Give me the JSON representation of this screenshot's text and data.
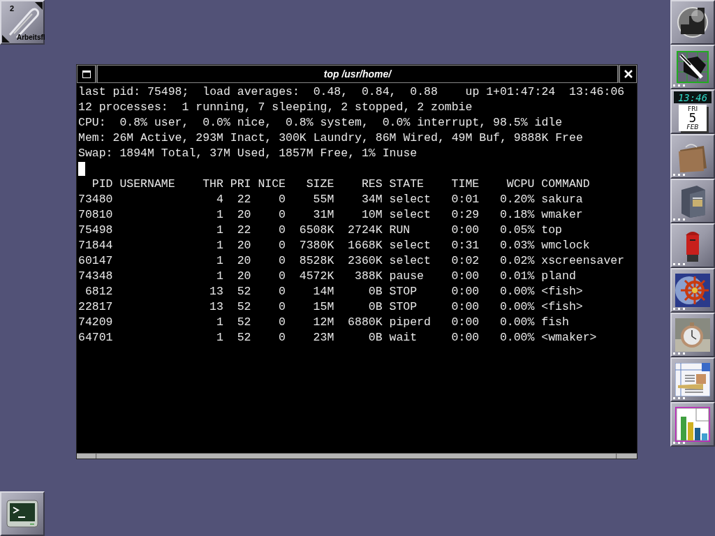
{
  "workspace": {
    "number": "2",
    "name": "Arbeitsfl"
  },
  "window": {
    "title": "top /usr/home/"
  },
  "terminal": {
    "summary": [
      "last pid: 75498;  load averages:  0.48,  0.84,  0.88    up 1+01:47:24  13:46:06",
      "12 processes:  1 running, 7 sleeping, 2 stopped, 2 zombie",
      "CPU:  0.8% user,  0.0% nice,  0.8% system,  0.0% interrupt, 98.5% idle",
      "Mem: 26M Active, 293M Inact, 300K Laundry, 86M Wired, 49M Buf, 9888K Free",
      "Swap: 1894M Total, 37M Used, 1857M Free, 1% Inuse"
    ]
  },
  "table": {
    "columns": [
      "PID",
      "USERNAME",
      "THR",
      "PRI",
      "NICE",
      "SIZE",
      "RES",
      "STATE",
      "TIME",
      "WCPU",
      "COMMAND"
    ],
    "rows": [
      {
        "pid": "73480",
        "thr": "4",
        "pri": "22",
        "nice": "0",
        "size": "55M",
        "res": "34M",
        "state": "select",
        "time": "0:01",
        "wcpu": "0.20%",
        "command": "sakura"
      },
      {
        "pid": "70810",
        "thr": "1",
        "pri": "20",
        "nice": "0",
        "size": "31M",
        "res": "10M",
        "state": "select",
        "time": "0:29",
        "wcpu": "0.18%",
        "command": "wmaker"
      },
      {
        "pid": "75498",
        "thr": "1",
        "pri": "22",
        "nice": "0",
        "size": "6508K",
        "res": "2724K",
        "state": "RUN",
        "time": "0:00",
        "wcpu": "0.05%",
        "command": "top"
      },
      {
        "pid": "71844",
        "thr": "1",
        "pri": "20",
        "nice": "0",
        "size": "7380K",
        "res": "1668K",
        "state": "select",
        "time": "0:31",
        "wcpu": "0.03%",
        "command": "wmclock"
      },
      {
        "pid": "60147",
        "thr": "1",
        "pri": "20",
        "nice": "0",
        "size": "8528K",
        "res": "2360K",
        "state": "select",
        "time": "0:02",
        "wcpu": "0.02%",
        "command": "xscreensaver"
      },
      {
        "pid": "74348",
        "thr": "1",
        "pri": "20",
        "nice": "0",
        "size": "4572K",
        "res": "388K",
        "state": "pause",
        "time": "0:00",
        "wcpu": "0.01%",
        "command": "pland"
      },
      {
        "pid": "6812",
        "thr": "13",
        "pri": "52",
        "nice": "0",
        "size": "14M",
        "res": "0B",
        "state": "STOP",
        "time": "0:00",
        "wcpu": "0.00%",
        "command": "<fish>"
      },
      {
        "pid": "22817",
        "thr": "13",
        "pri": "52",
        "nice": "0",
        "size": "15M",
        "res": "0B",
        "state": "STOP",
        "time": "0:00",
        "wcpu": "0.00%",
        "command": "<fish>"
      },
      {
        "pid": "74209",
        "thr": "1",
        "pri": "52",
        "nice": "0",
        "size": "12M",
        "res": "6880K",
        "state": "piperd",
        "time": "0:00",
        "wcpu": "0.00%",
        "command": "fish"
      },
      {
        "pid": "64701",
        "thr": "1",
        "pri": "52",
        "nice": "0",
        "size": "23M",
        "res": "0B",
        "state": "wait",
        "time": "0:00",
        "wcpu": "0.00%",
        "command": "<wmaker>"
      }
    ]
  },
  "dock": [
    {
      "kind": "sphere",
      "dots": false
    },
    {
      "kind": "tools",
      "dots": true
    },
    {
      "kind": "clock",
      "dots": false,
      "time": "13:46",
      "weekday": "FRI",
      "day": "5",
      "month": "FEB"
    },
    {
      "kind": "folder",
      "dots": true
    },
    {
      "kind": "cabinet",
      "dots": true
    },
    {
      "kind": "mailbox",
      "dots": true
    },
    {
      "kind": "helm",
      "dots": true
    },
    {
      "kind": "watch",
      "dots": true
    },
    {
      "kind": "writer",
      "dots": true
    },
    {
      "kind": "chart",
      "dots": true
    }
  ],
  "appicon": {
    "kind": "terminal"
  }
}
